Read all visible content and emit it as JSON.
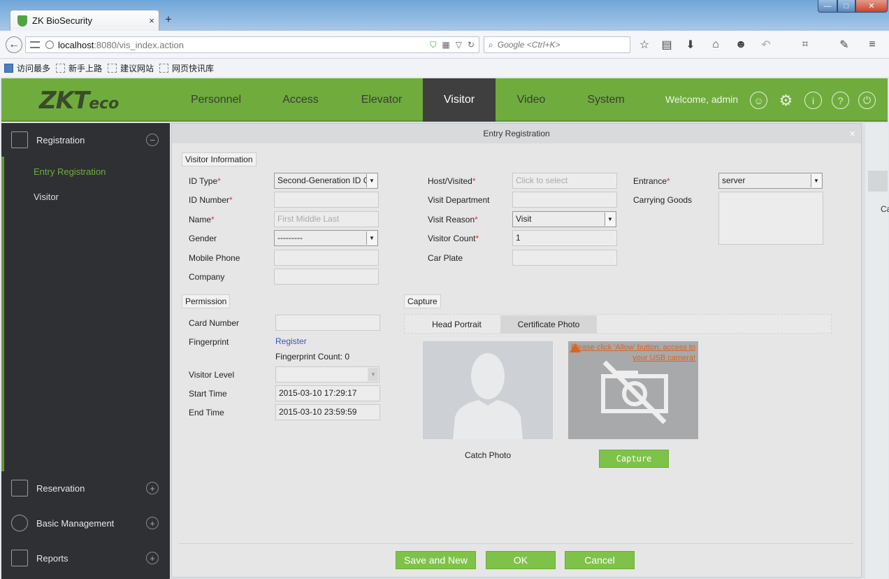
{
  "browser": {
    "tab_title": "ZK BioSecurity",
    "tab_close": "×",
    "new_tab": "+",
    "url_host": "localhost",
    "url_rest": ":8080/vis_index.action",
    "search_placeholder": "Google <Ctrl+K>",
    "bookmarks": [
      "访问最多",
      "新手上路",
      "建议网站",
      "网页快讯库"
    ],
    "window_buttons": {
      "minimize": "—",
      "maximize": "□",
      "close": "✕"
    }
  },
  "app": {
    "logo_main": "ZKT",
    "logo_eco": "eco",
    "menu": [
      "Personnel",
      "Access",
      "Elevator",
      "Visitor",
      "Video",
      "System"
    ],
    "active_menu": "Visitor",
    "welcome": "Welcome, admin",
    "accent_color": "#6fac3d"
  },
  "sidebar": {
    "registration": "Registration",
    "items": [
      "Entry Registration",
      "Visitor"
    ],
    "reservation": "Reservation",
    "basic_management": "Basic Management",
    "reports": "Reports"
  },
  "background": {
    "side_text": "Ca"
  },
  "dialog": {
    "title": "Entry Registration",
    "close": "×",
    "visitor_info": {
      "legend": "Visitor Information",
      "id_type_label": "ID Type",
      "id_type_value": "Second-Generation ID C",
      "id_number_label": "ID Number",
      "name_label": "Name",
      "name_placeholder": "First Middle Last",
      "gender_label": "Gender",
      "gender_value": "---------",
      "mobile_label": "Mobile Phone",
      "company_label": "Company",
      "host_label": "Host/Visited",
      "host_placeholder": "Click to select",
      "dept_label": "Visit Department",
      "reason_label": "Visit Reason",
      "reason_value": "Visit",
      "count_label": "Visitor Count",
      "count_value": "1",
      "car_label": "Car Plate",
      "entrance_label": "Entrance",
      "entrance_value": "server",
      "goods_label": "Carrying Goods"
    },
    "permission": {
      "legend": "Permission",
      "card_label": "Card Number",
      "finger_label": "Fingerprint",
      "register_link": "Register",
      "finger_count": "Fingerprint Count: 0",
      "level_label": "Visitor Level",
      "start_label": "Start Time",
      "start_value": "2015-03-10 17:29:17",
      "end_label": "End Time",
      "end_value": "2015-03-10 23:59:59"
    },
    "capture": {
      "legend": "Capture",
      "tab_head": "Head Portrait",
      "tab_cert": "Certificate Photo",
      "warning": "Please click 'Allow' button, access to your USB camera!",
      "catch_photo": "Catch Photo",
      "capture_button": "Capture"
    },
    "buttons": {
      "save_new": "Save and New",
      "ok": "OK",
      "cancel": "Cancel"
    }
  }
}
